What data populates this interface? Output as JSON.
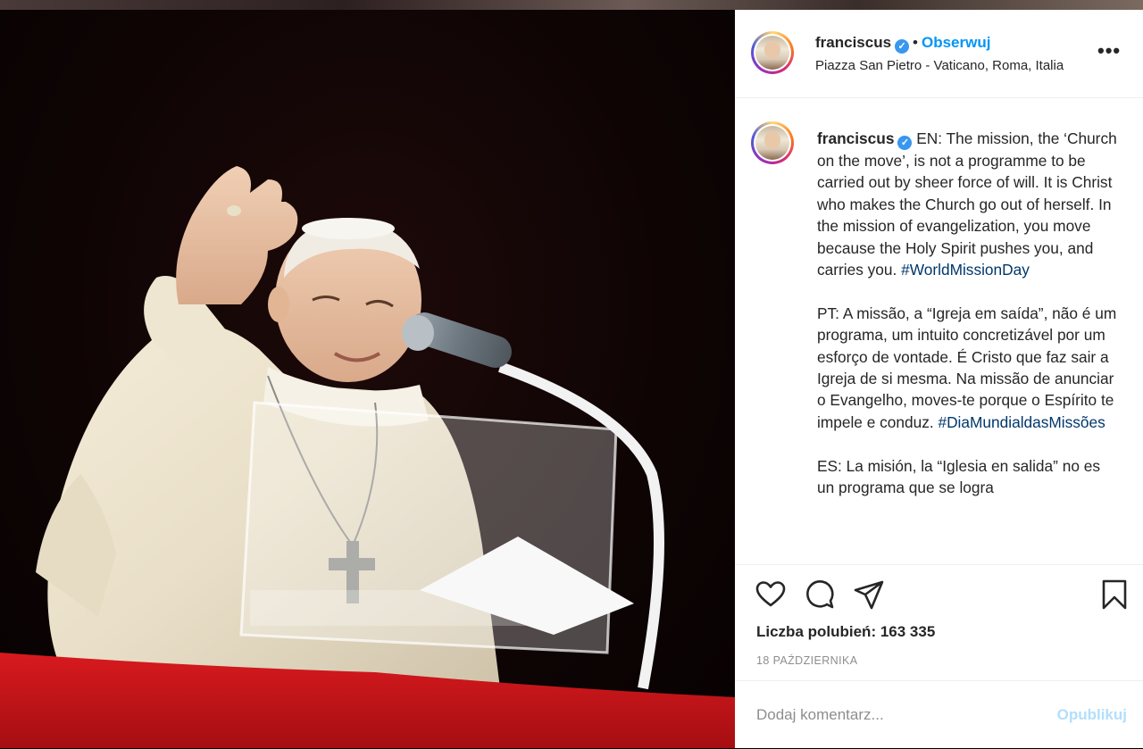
{
  "post": {
    "username": "franciscus",
    "verified_glyph": "✓",
    "follow_label": "Obserwuj",
    "separator": "•",
    "location": "Piazza San Pietro - Vaticano, Roma, Italia",
    "more_label": "•••"
  },
  "caption": {
    "username": "franciscus",
    "en_text": "EN: The mission, the ‘Church on the move’, is not a programme to be carried out by sheer force of will. It is Christ who makes the Church go out of herself. In the mission of evangelization, you move because the Holy Spirit pushes you, and carries you.",
    "en_hashtag": "#WorldMissionDay",
    "pt_text": "PT: A missão, a “Igreja em saída”, não é um programa, um intuito concretizável por um esforço de vontade. É Cristo que faz sair a Igreja de si mesma. Na missão de anunciar o Evangelho, moves-te porque o Espírito te impele e conduz.",
    "pt_hashtag": "#DiaMundialdasMissões",
    "es_text": "ES: La misión, la “Iglesia en salida” no es un programa que se logra"
  },
  "actions": {
    "icons": [
      "heart-icon",
      "comment-icon",
      "share-icon",
      "bookmark-icon"
    ],
    "likes_label": "Liczba polubień: 163 335",
    "date": "18 PAŹDZIERNIKA"
  },
  "comment": {
    "placeholder": "Dodaj komentarz...",
    "publish_label": "Opublikuj"
  },
  "colors": {
    "accent": "#0095f6",
    "hashtag": "#00376b",
    "publish_disabled": "#b2dffc",
    "muted": "#8e8e8e",
    "balcony_red": "#c8141a"
  }
}
